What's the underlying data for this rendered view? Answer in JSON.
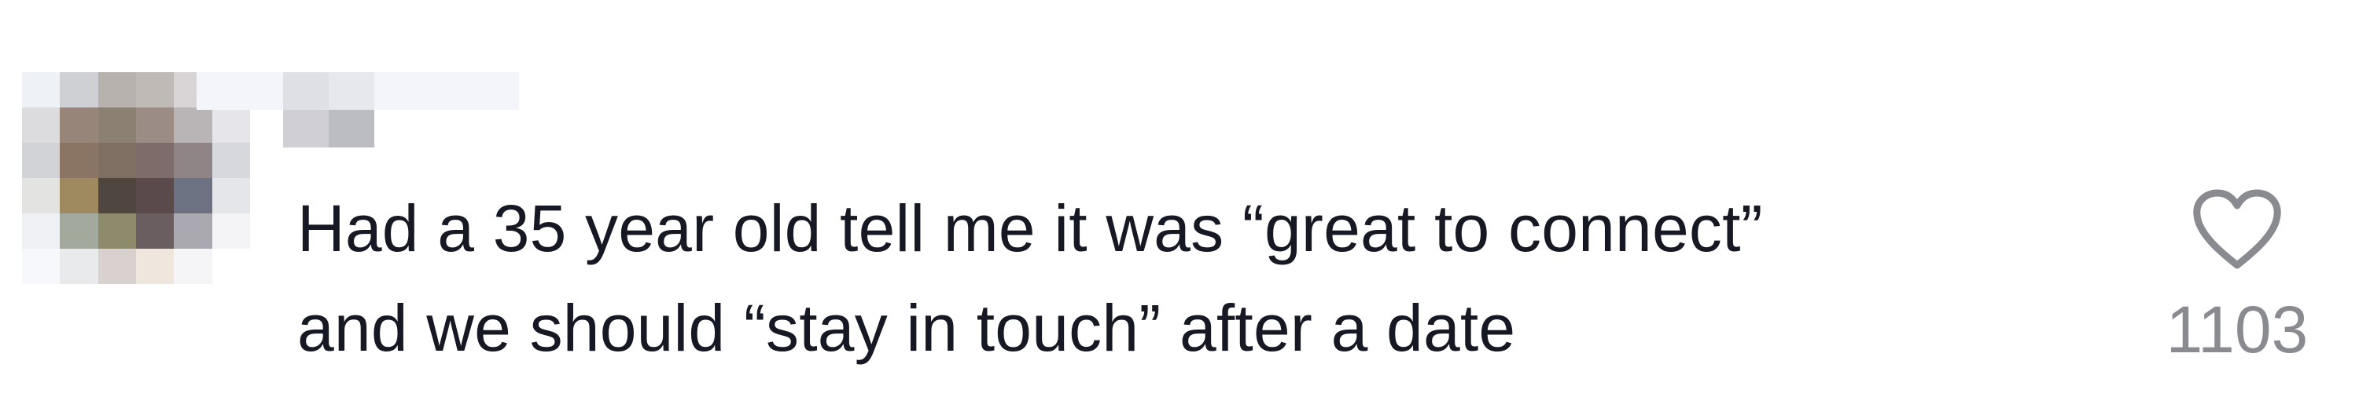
{
  "comment": {
    "text_line_1": "Had a 35 year old tell me it was “great to connect”",
    "text_line_2": "and we should “stay in touch” after a date",
    "like_count": "1103"
  },
  "icons": {
    "like": "heart-outline-icon",
    "avatar": "pixelated-avatar"
  },
  "colors": {
    "text": "#161823",
    "muted": "#8a8b91",
    "icon": "#8a8b91",
    "background": "#ffffff"
  }
}
